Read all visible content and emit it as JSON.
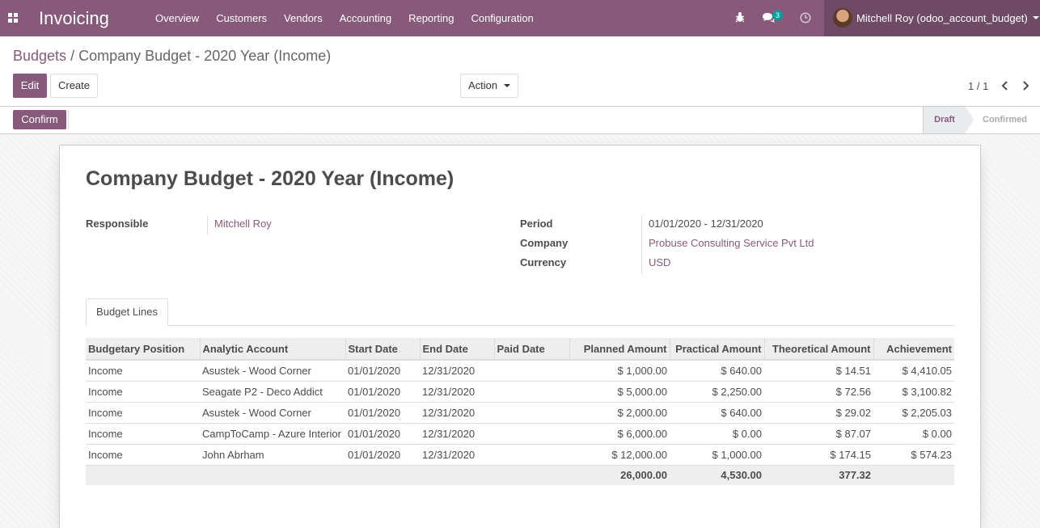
{
  "navbar": {
    "app_name": "Invoicing",
    "menu": [
      "Overview",
      "Customers",
      "Vendors",
      "Accounting",
      "Reporting",
      "Configuration"
    ],
    "messages_count": "3",
    "user_name": "Mitchell Roy (odoo_account_budget)",
    "accent": "#875a7b"
  },
  "breadcrumb": {
    "parent": "Budgets",
    "separator": "/",
    "current": "Company Budget - 2020 Year (Income)"
  },
  "control": {
    "edit_label": "Edit",
    "create_label": "Create",
    "action_label": "Action",
    "pager": "1 / 1"
  },
  "status": {
    "confirm_label": "Confirm",
    "stages": [
      "Draft",
      "Confirmed"
    ],
    "current": "Draft"
  },
  "form": {
    "title": "Company Budget - 2020 Year (Income)",
    "responsible_label": "Responsible",
    "responsible": "Mitchell Roy",
    "period_label": "Period",
    "period": "01/01/2020 - 12/31/2020",
    "company_label": "Company",
    "company": "Probuse Consulting Service Pvt Ltd",
    "currency_label": "Currency",
    "currency": "USD"
  },
  "tabs": [
    "Budget Lines"
  ],
  "table": {
    "columns": [
      "Budgetary Position",
      "Analytic Account",
      "Start Date",
      "End Date",
      "Paid Date",
      "Planned Amount",
      "Practical Amount",
      "Theoretical Amount",
      "Achievement"
    ],
    "rows": [
      [
        "Income",
        "Asustek - Wood Corner",
        "01/01/2020",
        "12/31/2020",
        "",
        "$ 1,000.00",
        "$ 640.00",
        "$ 14.51",
        "$ 4,410.05"
      ],
      [
        "Income",
        "Seagate P2 - Deco Addict",
        "01/01/2020",
        "12/31/2020",
        "",
        "$ 5,000.00",
        "$ 2,250.00",
        "$ 72.56",
        "$ 3,100.82"
      ],
      [
        "Income",
        "Asustek - Wood Corner",
        "01/01/2020",
        "12/31/2020",
        "",
        "$ 2,000.00",
        "$ 640.00",
        "$ 29.02",
        "$ 2,205.03"
      ],
      [
        "Income",
        "CampToCamp - Azure Interior",
        "01/01/2020",
        "12/31/2020",
        "",
        "$ 6,000.00",
        "$ 0.00",
        "$ 87.07",
        "$ 0.00"
      ],
      [
        "Income",
        "John Abrham",
        "01/01/2020",
        "12/31/2020",
        "",
        "$ 12,000.00",
        "$ 1,000.00",
        "$ 174.15",
        "$ 574.23"
      ]
    ],
    "totals": [
      "",
      "",
      "",
      "",
      "",
      "26,000.00",
      "4,530.00",
      "377.32",
      ""
    ]
  }
}
